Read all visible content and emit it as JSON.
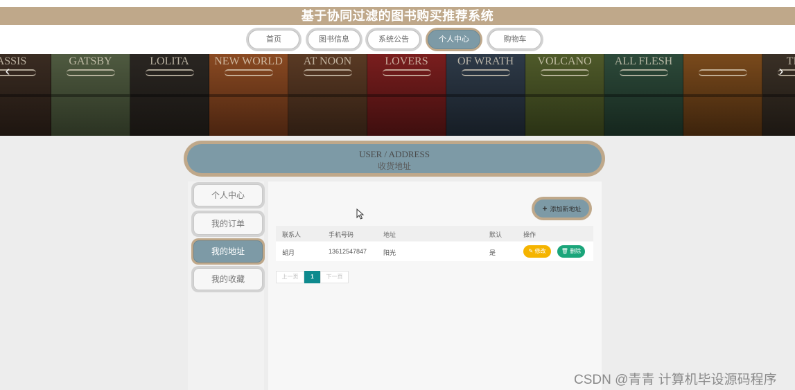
{
  "app": {
    "title": "基于协同过滤的图书购买推荐系统"
  },
  "nav": {
    "items": [
      "首页",
      "图书信息",
      "系统公告",
      "个人中心",
      "购物车"
    ],
    "active": "个人中心"
  },
  "banner": {
    "book_titles": [
      "ASSIS",
      "GATSBY",
      "LOLITA",
      "NEW WORLD",
      "AT NOON",
      "LOVERS",
      "OF WRATH",
      "VOLCANO",
      "ALL FLESH",
      "",
      "TRAG"
    ],
    "prev_icon": "chevron-left-icon",
    "next_icon": "chevron-right-icon",
    "prev_glyph": "‹",
    "next_glyph": "›"
  },
  "header": {
    "en": "USER / ADDRESS",
    "cn": "收货地址"
  },
  "sidebar": {
    "items": [
      "个人中心",
      "我的订单",
      "我的地址",
      "我的收藏"
    ],
    "active": "我的地址"
  },
  "actions": {
    "add_address": "添加新地址",
    "add_glyph": "+"
  },
  "table": {
    "columns": [
      "联系人",
      "手机号码",
      "地址",
      "默认",
      "操作"
    ],
    "rows": [
      {
        "contact": "胡月",
        "phone": "13612547847",
        "address": "阳光",
        "default": "是",
        "edit": "修改",
        "delete": "删除"
      }
    ]
  },
  "pagination": {
    "prev": "上一页",
    "current": "1",
    "next": "下一页"
  },
  "watermark": "CSDN @青青  计算机毕设源码程序",
  "colors": {
    "accent": "#bfa88a",
    "slate": "#7d9aa6",
    "edit": "#f5b400",
    "delete": "#1aa57a",
    "page": "#0e8a8e"
  }
}
